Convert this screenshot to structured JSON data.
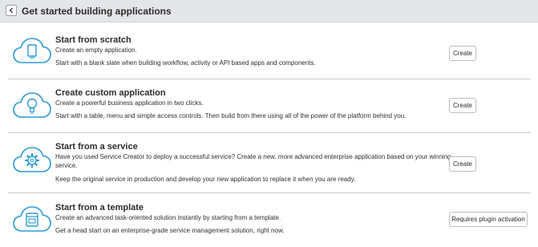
{
  "header": {
    "title": "Get started building applications",
    "back_icon": "chevron-left-icon"
  },
  "colors": {
    "icon_blue": "#2b9ad4",
    "divider": "#c9cdd1",
    "header_bg": "#e4e6e9"
  },
  "cards": [
    {
      "title": "Start from scratch",
      "subtitle": "Create an empty application.",
      "description": "Start with a blank slate when building workflow, activity or API based apps and components.",
      "button_label": "Create",
      "icon": "cloud-document-icon"
    },
    {
      "title": "Create custom application",
      "subtitle": "Create a powerful business application in two clicks.",
      "description": "Start with a table, menu and simple access controls. Then build from there using all of the power of the platform behind you.",
      "button_label": "Create",
      "icon": "cloud-lightbulb-icon"
    },
    {
      "title": "Start from a service",
      "subtitle_line1": "Have you used Service Creator to deploy a successful service? Create a new, more advanced enterprise application based on your winning",
      "subtitle_line2": "service.",
      "description": "Keep the original service in production and develop your new application to replace it when you are ready.",
      "button_label": "Create",
      "icon": "cloud-gear-icon"
    },
    {
      "title": "Start from a template",
      "subtitle": "Create an advanced task-oriented solution instantly by starting from a template.",
      "description": "Get a head start on an enterprise-grade service management solution, right now.",
      "button_label": "Requires plugin activation",
      "icon": "cloud-template-icon"
    }
  ]
}
